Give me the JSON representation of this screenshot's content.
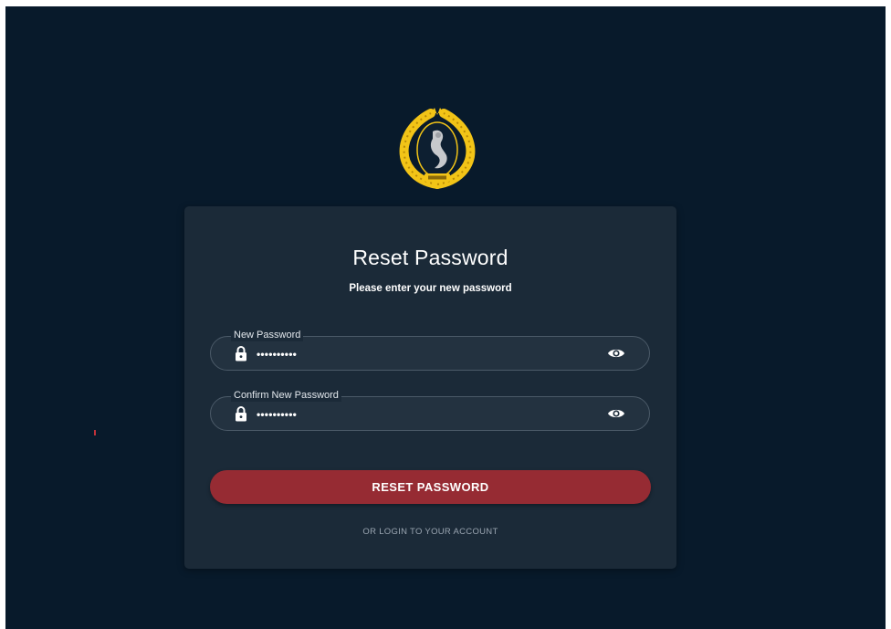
{
  "card": {
    "title": "Reset Password",
    "subtitle": "Please enter your new password"
  },
  "fields": [
    {
      "label": "New Password",
      "value_masked": "••••••••••",
      "icon": "lock-icon",
      "toggle_icon": "eye-icon"
    },
    {
      "label": "Confirm New Password",
      "value_masked": "••••••••••",
      "icon": "lock-icon",
      "toggle_icon": "eye-icon"
    }
  ],
  "actions": {
    "reset_label": "RESET PASSWORD",
    "login_link": "OR LOGIN TO YOUR ACCOUNT"
  },
  "colors": {
    "background": "#081a2b",
    "card": "#1b2a38",
    "button": "#962b33",
    "logo_gold": "#f2c417"
  }
}
